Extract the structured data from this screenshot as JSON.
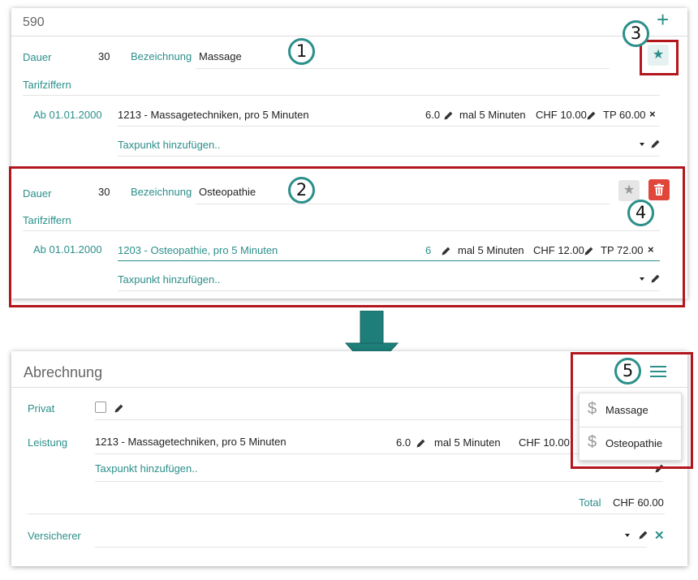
{
  "top_panel": {
    "record_id": "590",
    "add_icon": "plus-icon",
    "entry1": {
      "dauer_label": "Dauer",
      "dauer_value": "30",
      "bezeichnung_label": "Bezeichnung",
      "bezeichnung_value": "Massage",
      "tarifziffern_label": "Tarifziffern",
      "date": "Ab 01.01.2000",
      "code_desc": "1213 - Massagetechniken, pro 5 Minuten",
      "qty": "6.0",
      "mal": "mal 5 Minuten",
      "price": "CHF 10.00",
      "tp": "TP 60.00",
      "remove": "×",
      "taxpunkt_placeholder": "Taxpunkt hinzufügen..",
      "star": "★"
    },
    "entry2": {
      "dauer_label": "Dauer",
      "dauer_value": "30",
      "bezeichnung_label": "Bezeichnung",
      "bezeichnung_value": "Osteopathie",
      "tarifziffern_label": "Tarifziffern",
      "date": "Ab 01.01.2000",
      "code_desc": "1203 - Osteopathie, pro 5 Minuten",
      "qty": "6",
      "mal": "mal 5 Minuten",
      "price": "CHF 12.00",
      "tp": "TP 72.00",
      "remove": "×",
      "taxpunkt_placeholder": "Taxpunkt hinzufügen..",
      "star": "★"
    }
  },
  "badges": [
    "1",
    "2",
    "3",
    "4",
    "5"
  ],
  "bottom_panel": {
    "title": "Abrechnung",
    "menu_icon": "hamburger-icon",
    "privat_label": "Privat",
    "leistung_label": "Leistung",
    "leistung_code": "1213 - Massagetechniken, pro 5 Minuten",
    "leistung_qty": "6.0",
    "leistung_mal": "mal 5 Minuten",
    "leistung_price": "CHF 10.00",
    "taxpunkt_placeholder": "Taxpunkt hinzufügen..",
    "total_label": "Total",
    "total_value": "CHF 60.00",
    "versicherer_label": "Versicherer",
    "clear": "✕",
    "menu_items": [
      {
        "icon": "dollar-icon",
        "label": "Massage"
      },
      {
        "icon": "dollar-icon",
        "label": "Osteopathie"
      }
    ]
  },
  "colors": {
    "teal": "#2b8f8a",
    "highlight_red": "#b3161d",
    "delete_red": "#e0463a",
    "star_gray_bg": "#e6e6e6"
  }
}
